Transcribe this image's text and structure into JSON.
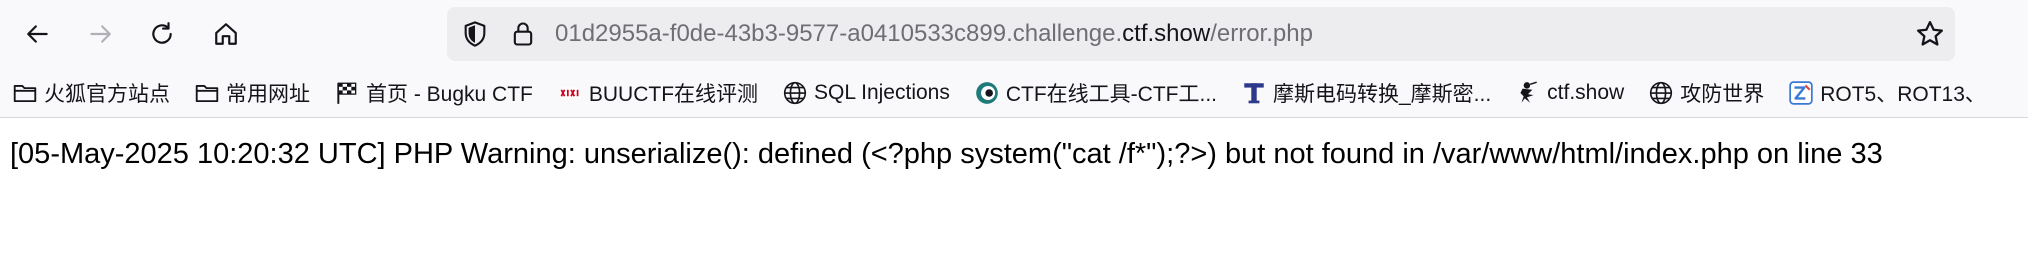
{
  "colors": {
    "toolbar_bg": "#f9f9fb",
    "urlbar_bg": "#ededf0",
    "url_dim_text": "#6e6e75",
    "text": "#15141a",
    "forward_disabled": "#b0b0b6"
  },
  "toolbar": {
    "back_icon": "arrow-left-icon",
    "forward_icon": "arrow-right-icon",
    "reload_icon": "reload-icon",
    "home_icon": "home-icon"
  },
  "url": {
    "prefix": "01d2955a-f0de-43b3-9577-a0410533c899.challenge.",
    "domain": "ctf.show",
    "path": "/error.php",
    "security_icon": "shield-icon",
    "lock_icon": "lock-icon",
    "bookmark_icon": "star-icon"
  },
  "bookmarks": [
    {
      "label": "火狐官方站点",
      "icon": "folder-icon"
    },
    {
      "label": "常用网址",
      "icon": "folder-icon"
    },
    {
      "label": "首页 - Bugku CTF",
      "icon": "flag-icon"
    },
    {
      "label": "BUUCTF在线评测",
      "icon": "buuctf-icon"
    },
    {
      "label": "SQL Injections",
      "icon": "globe-icon"
    },
    {
      "label": "CTF在线工具-CTF工...",
      "icon": "ctf-tools-icon"
    },
    {
      "label": "摩斯电码转换_摩斯密...",
      "icon": "morse-t-icon"
    },
    {
      "label": "ctf.show",
      "icon": "ninja-icon"
    },
    {
      "label": "攻防世界",
      "icon": "globe-icon"
    },
    {
      "label": "ROT5、ROT13、",
      "icon": "rot-icon"
    }
  ],
  "page": {
    "error_text": "[05-May-2025 10:20:32 UTC] PHP Warning: unserialize(): defined (<?php system(\"cat /f*\");?>) but not found in /var/www/html/index.php on line 33"
  }
}
